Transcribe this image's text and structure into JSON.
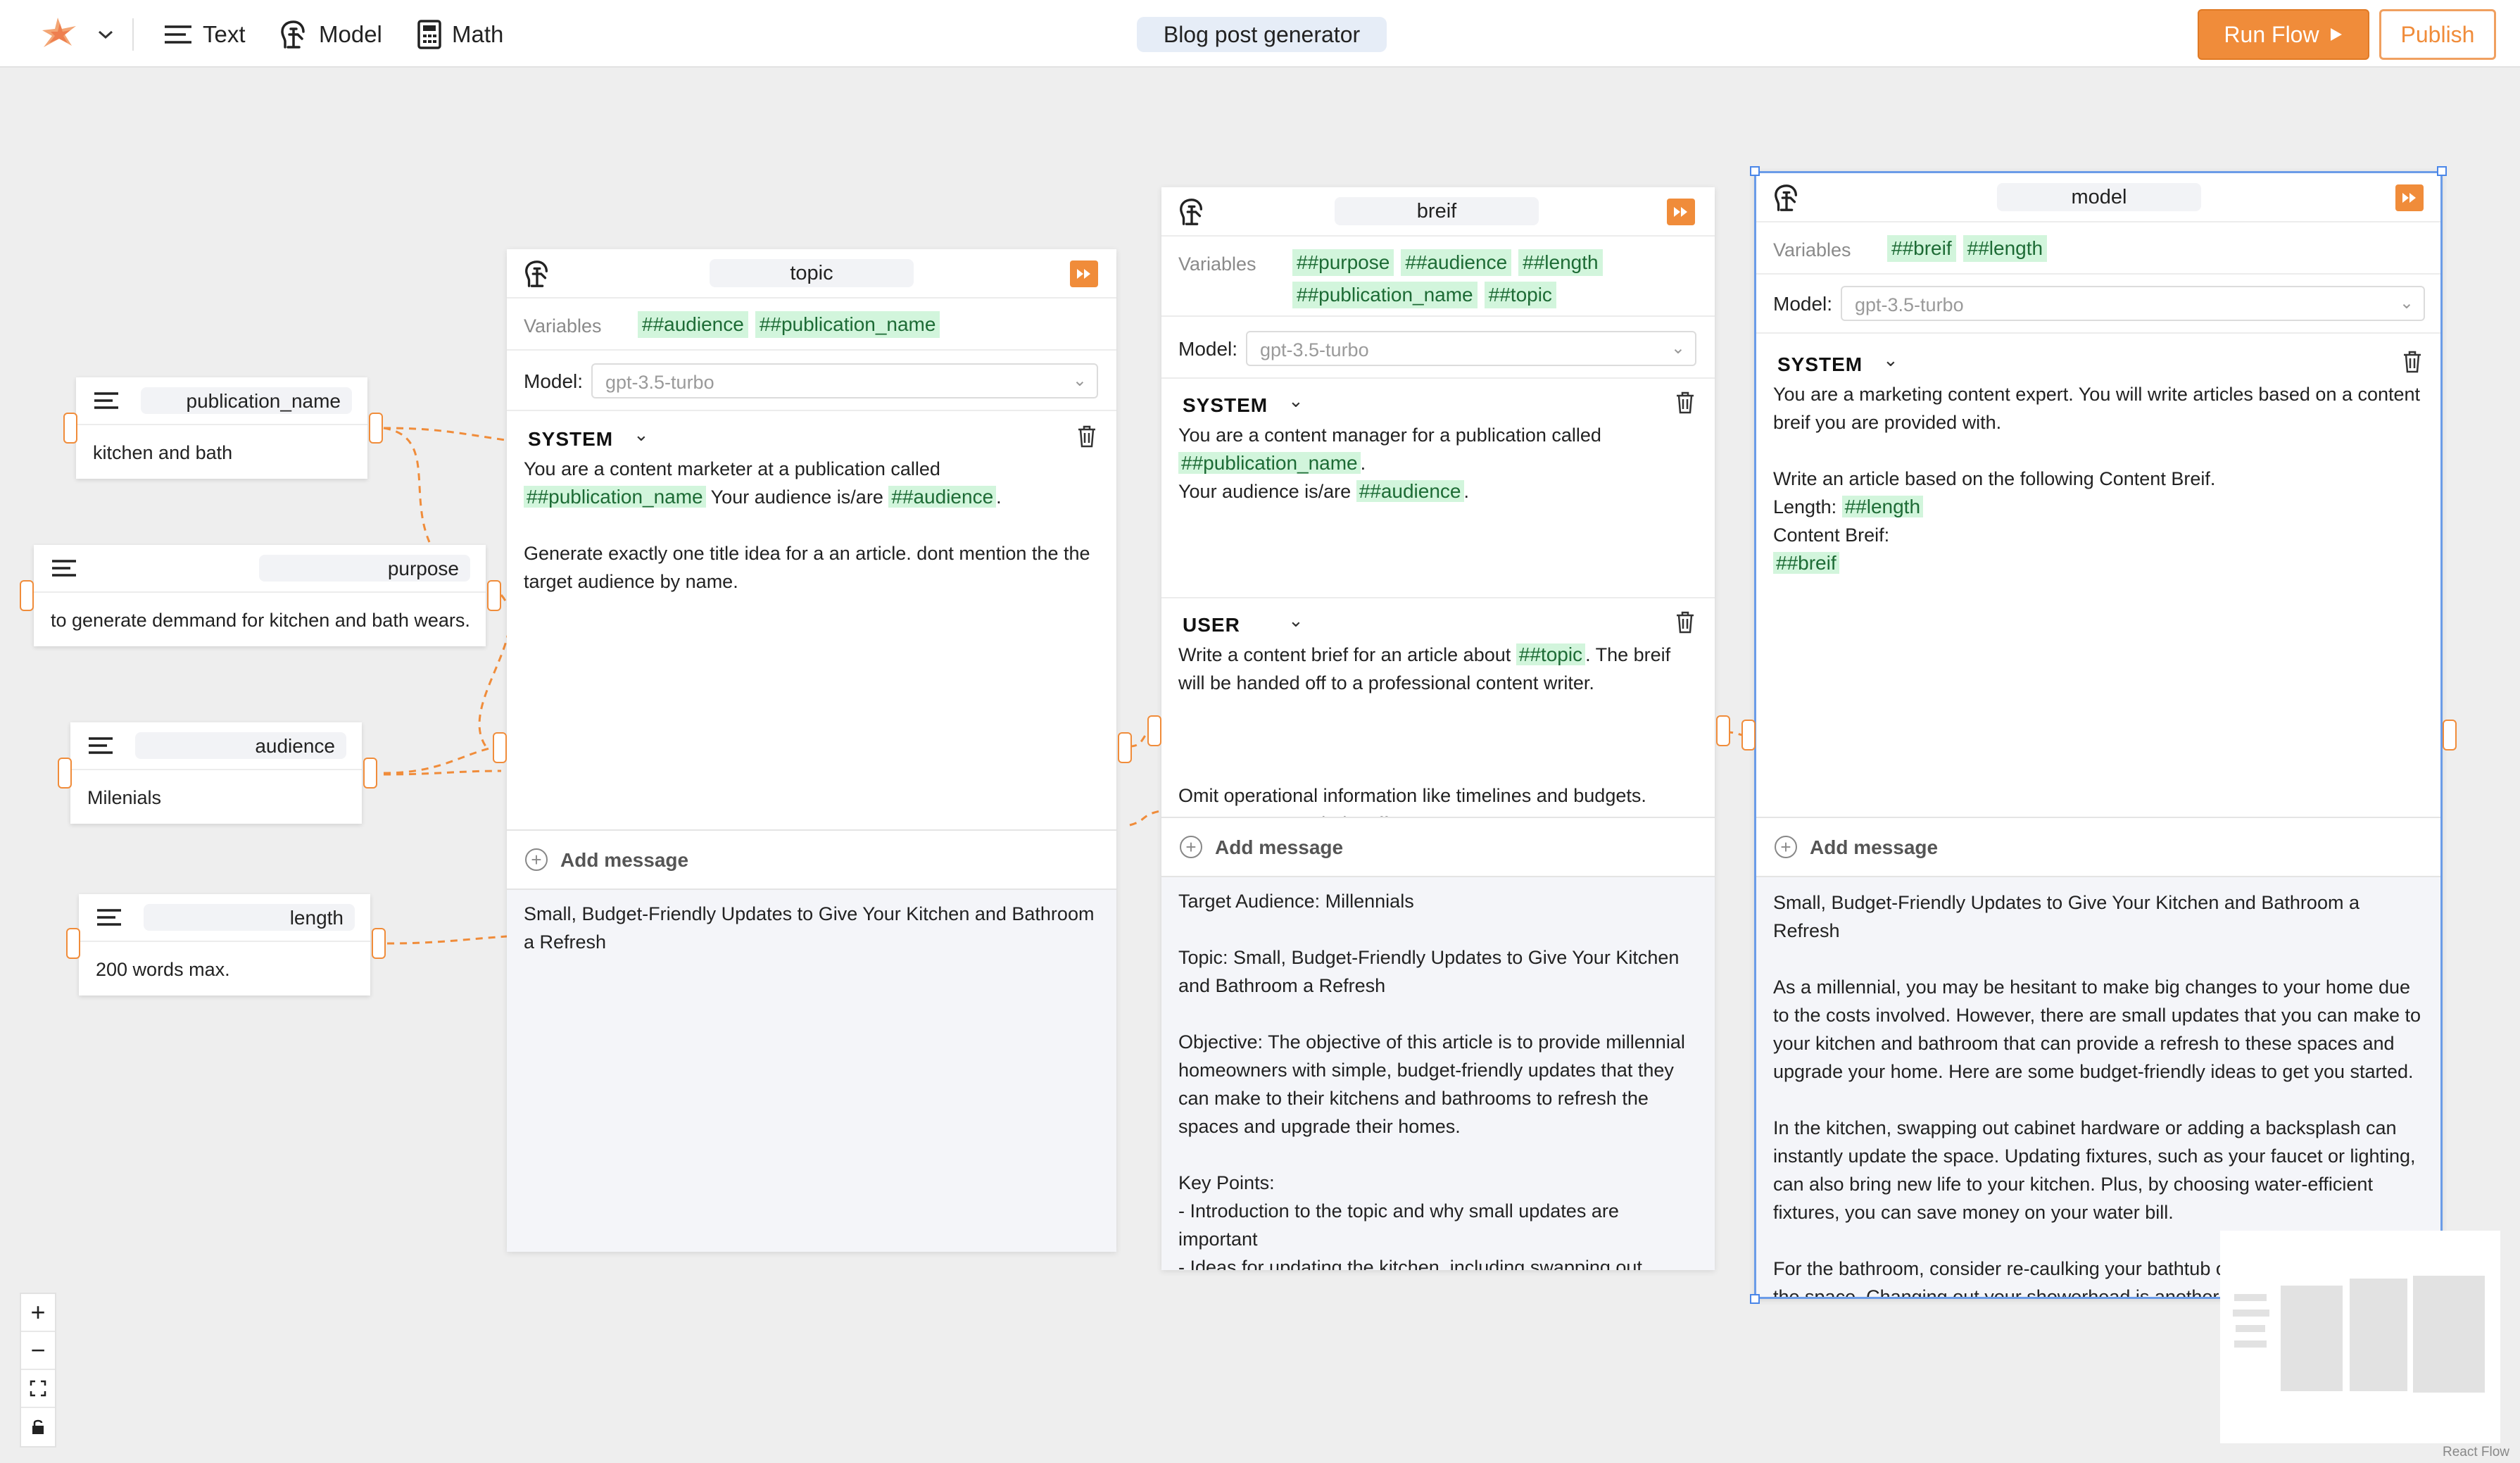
{
  "toolbar": {
    "logo_icon": "sparkle-logo-icon",
    "items": [
      {
        "label": "Text",
        "icon": "text-lines-icon"
      },
      {
        "label": "Model",
        "icon": "brain-icon"
      },
      {
        "label": "Math",
        "icon": "calculator-icon"
      }
    ],
    "title": "Blog post generator",
    "run_label": "Run Flow",
    "publish_label": "Publish",
    "accent": "#f08c3a"
  },
  "variables": [
    {
      "name": "publication_name",
      "value": "kitchen and bath"
    },
    {
      "name": "purpose",
      "value": "to generate demmand for kitchen and bath wears."
    },
    {
      "name": "audience",
      "value": "Milenials"
    },
    {
      "name": "length",
      "value": "200 words max."
    }
  ],
  "models": [
    {
      "title": "topic",
      "variables_label": "Variables",
      "variables": [
        "##audience",
        "##publication_name"
      ],
      "model_label": "Model:",
      "model": "gpt-3.5-turbo",
      "messages": [
        {
          "role": "SYSTEM",
          "text": [
            {
              "t": "You are a content marketer at a publication called "
            },
            {
              "v": "##publication_name"
            },
            {
              "t": " Your audience is/are "
            },
            {
              "v": "##audience"
            },
            {
              "t": ".\n\nGenerate exactly one title idea for a an article. dont mention the the target audience by name."
            }
          ]
        }
      ],
      "add_message_label": "Add message",
      "output": "Small, Budget-Friendly Updates to Give Your Kitchen and Bathroom a Refresh"
    },
    {
      "title": "breif",
      "variables_label": "Variables",
      "variables": [
        "##purpose",
        "##audience",
        "##length",
        "##publication_name",
        "##topic"
      ],
      "model_label": "Model:",
      "model": "gpt-3.5-turbo",
      "messages": [
        {
          "role": "SYSTEM",
          "text": [
            {
              "t": "You are a content manager for a publication called "
            },
            {
              "v": "##publication_name"
            },
            {
              "t": ".\nYour audience is/are "
            },
            {
              "v": "##audience"
            },
            {
              "t": "."
            }
          ]
        },
        {
          "role": "USER",
          "text": [
            {
              "t": "Write a content brief for an article about "
            },
            {
              "v": "##topic"
            },
            {
              "t": ". The breif will be handed off to a professional content writer.\n\n\n\nOmit operational information like timelines and budgets.\nDon't say unneeded stuff."
            }
          ]
        }
      ],
      "add_message_label": "Add message",
      "output": "Target Audience: Millennials\n\nTopic: Small, Budget-Friendly Updates to Give Your Kitchen and Bathroom a Refresh\n\nObjective: The objective of this article is to provide millennial homeowners with simple, budget-friendly updates that they can make to their kitchens and bathrooms to refresh the spaces and upgrade their homes.\n\nKey Points:\n- Introduction to the topic and why small updates are important\n- Ideas for updating the kitchen, including swapping out"
    },
    {
      "title": "model",
      "variables_label": "Variables",
      "variables": [
        "##breif",
        "##length"
      ],
      "model_label": "Model:",
      "model": "gpt-3.5-turbo",
      "messages": [
        {
          "role": "SYSTEM",
          "text": [
            {
              "t": "You are a marketing content expert. You will write articles based on a content breif you are provided with.\n\nWrite an article based on the following Content Breif.\nLength: "
            },
            {
              "v": "##length"
            },
            {
              "t": "\nContent Breif:\n"
            },
            {
              "v": "##breif"
            }
          ]
        }
      ],
      "add_message_label": "Add message",
      "output": "Small, Budget-Friendly Updates to Give Your Kitchen and Bathroom a Refresh\n\nAs a millennial, you may be hesitant to make big changes to your home due to the costs involved. However, there are small updates that you can make to your kitchen and bathroom that can provide a refresh to these spaces and upgrade your home. Here are some budget-friendly ideas to get you started.\n\nIn the kitchen, swapping out cabinet hardware or adding a backsplash can instantly update the space. Updating fixtures, such as your faucet or lighting, can also bring new life to your kitchen. Plus, by choosing water-efficient fixtures, you can save money on your water bill.\n\nFor the bathroom, consider re-caulking your bathtub or shower to freshen up the space. Changing out your showerhead is another small update that can make a big difference. Adding new textiles, such as a"
    }
  ],
  "zoom_controls": [
    "+",
    "−",
    "fit-view-icon",
    "lock-icon"
  ],
  "attribution": "React Flow"
}
